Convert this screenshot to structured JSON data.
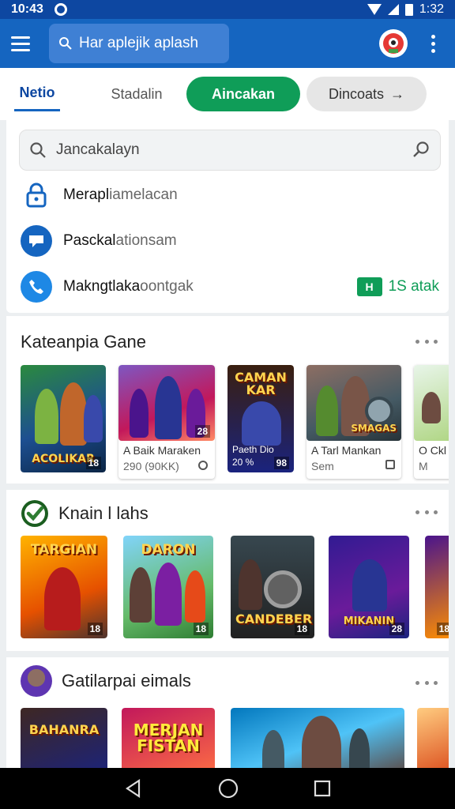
{
  "status": {
    "time": "10:43",
    "right_text": "1:32"
  },
  "appbar": {
    "search_text": "Har aplejik aplash"
  },
  "tabs": [
    {
      "label": "Netio"
    },
    {
      "label": "Stadalin"
    },
    {
      "label": "Aincakan"
    },
    {
      "label": "Dincoats"
    }
  ],
  "search": {
    "placeholder": "Jancakalayn",
    "suggestions": [
      {
        "strong": "Merapl",
        "light": "iamelacan",
        "icon": "lock-icon"
      },
      {
        "strong": "Pasckal",
        "light": "ationsam",
        "icon": "chat-icon"
      },
      {
        "strong": "Makngtlaka",
        "light": "oontgak",
        "icon": "phone-icon",
        "badge_text": "1S atak",
        "badge_icon_text": "H"
      }
    ]
  },
  "sections": [
    {
      "title": "Kateanpia Gane",
      "cards": [
        {
          "art_title": "ACOLIKAR",
          "corner": "18"
        },
        {
          "art_title": "",
          "corner": "28",
          "caption": "A Baik Maraken",
          "subcaption": "290 (90KK)"
        },
        {
          "art_title": "CAMAN KAR",
          "corner": "98",
          "caption": "Paeth Dio",
          "subcaption": "20 %"
        },
        {
          "art_title": "SMAGAS",
          "corner": "",
          "caption": "A Tarl Mankan",
          "subcaption": "Sem"
        },
        {
          "art_title": "",
          "corner": "",
          "caption": "O Ckl",
          "subcaption": "M"
        }
      ]
    },
    {
      "title": "Knain l lahs",
      "cards": [
        {
          "art_title": "TARGIAN",
          "corner": "18"
        },
        {
          "art_title": "DARON",
          "corner": "18"
        },
        {
          "art_title": "CANDEBER",
          "corner": "18"
        },
        {
          "art_title": "MIKANIN",
          "corner": "28"
        },
        {
          "art_title": "",
          "corner": "18"
        }
      ]
    },
    {
      "title": "Gatilarpai eimals",
      "cards": [
        {
          "art_title": "BAHANRA"
        },
        {
          "art_title": "MERJAN FISTAN"
        },
        {
          "art_title": ""
        },
        {
          "art_title": ""
        }
      ]
    }
  ],
  "colors": {
    "primary": "#1565c0",
    "accent_green": "#0f9d58",
    "status_bar": "#0d47a1"
  }
}
